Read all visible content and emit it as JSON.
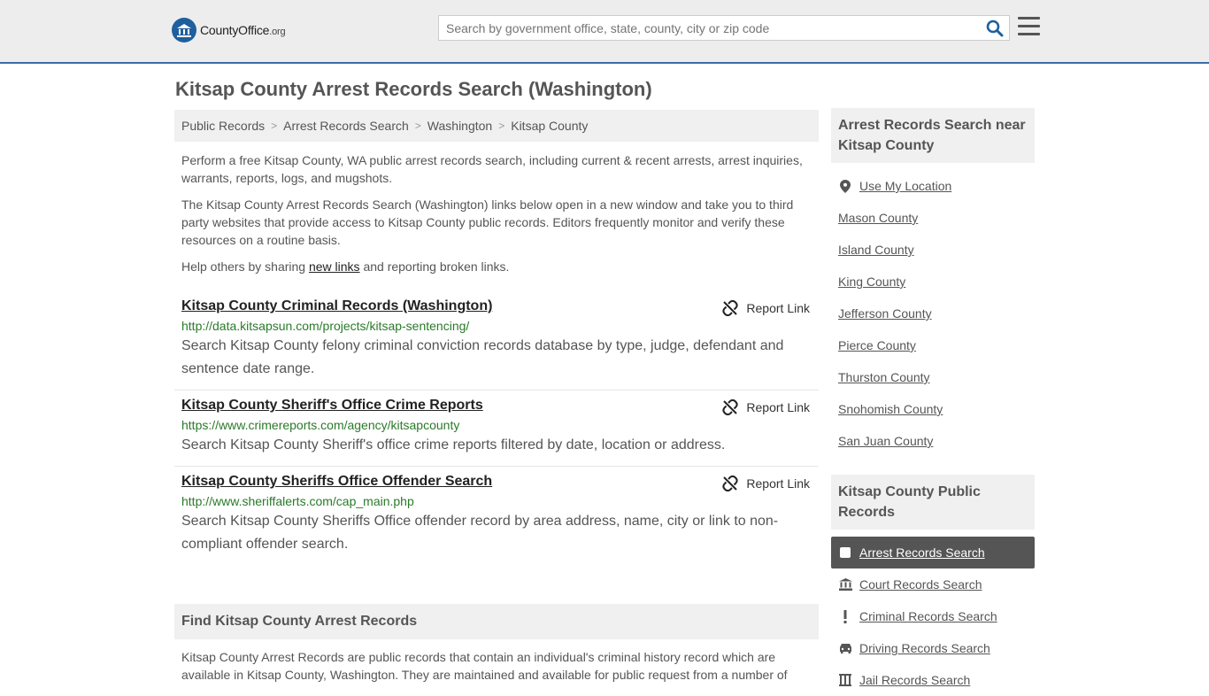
{
  "header": {
    "logo_main": "CountyOffice",
    "logo_suffix": ".org",
    "search_placeholder": "Search by government office, state, county, city or zip code"
  },
  "page": {
    "title": "Kitsap County Arrest Records Search (Washington)"
  },
  "breadcrumb": [
    "Public Records",
    "Arrest Records Search",
    "Washington",
    "Kitsap County"
  ],
  "intro": {
    "p1": "Perform a free Kitsap County, WA public arrest records search, including current & recent arrests, arrest inquiries, warrants, reports, logs, and mugshots.",
    "p2": "The Kitsap County Arrest Records Search (Washington) links below open in a new window and take you to third party websites that provide access to Kitsap County public records. Editors frequently monitor and verify these resources on a routine basis.",
    "p3_before": "Help others by sharing ",
    "p3_link": "new links",
    "p3_after": " and reporting broken links."
  },
  "records": [
    {
      "title": "Kitsap County Criminal Records (Washington)",
      "url": "http://data.kitsapsun.com/projects/kitsap-sentencing/",
      "description": "Search Kitsap County felony criminal conviction records database by type, judge, defendant and sentence date range.",
      "report_label": "Report Link"
    },
    {
      "title": "Kitsap County Sheriff's Office Crime Reports",
      "url": "https://www.crimereports.com/agency/kitsapcounty",
      "description": "Search Kitsap County Sheriff's office crime reports filtered by date, location or address.",
      "report_label": "Report Link"
    },
    {
      "title": "Kitsap County Sheriffs Office Offender Search",
      "url": "http://www.sheriffalerts.com/cap_main.php",
      "description": "Search Kitsap County Sheriffs Office offender record by area address, name, city or link to non-compliant offender search.",
      "report_label": "Report Link"
    }
  ],
  "find": {
    "heading": "Find Kitsap County Arrest Records",
    "text": "Kitsap County Arrest Records are public records that contain an individual's criminal history record which are available in Kitsap County, Washington. They are maintained and available for public request from a number of"
  },
  "sidebar": {
    "nearby_heading": "Arrest Records Search near Kitsap County",
    "use_location": "Use My Location",
    "nearby": [
      "Mason County",
      "Island County",
      "King County",
      "Jefferson County",
      "Pierce County",
      "Thurston County",
      "Snohomish County",
      "San Juan County"
    ],
    "records_heading": "Kitsap County Public Records",
    "records": [
      {
        "label": "Arrest Records Search",
        "icon": "checkbox-icon",
        "active": true
      },
      {
        "label": "Court Records Search",
        "icon": "courthouse-icon",
        "active": false
      },
      {
        "label": "Criminal Records Search",
        "icon": "exclamation-icon",
        "active": false
      },
      {
        "label": "Driving Records Search",
        "icon": "car-icon",
        "active": false
      },
      {
        "label": "Jail Records Search",
        "icon": "jail-icon",
        "active": false
      }
    ]
  },
  "colors": {
    "accent_border": "#3a6ea5",
    "search_icon": "#1f5f9d",
    "url_green": "#2a7a2a",
    "active_bg": "#555555"
  }
}
